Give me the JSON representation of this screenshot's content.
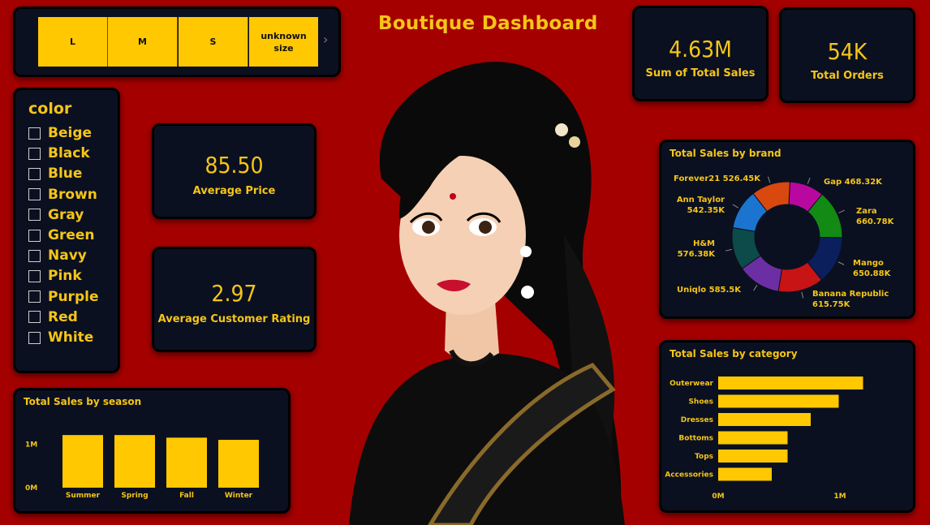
{
  "dashboard_title": "Boutique Dashboard",
  "size_slicer": {
    "options": [
      "L",
      "M",
      "S",
      "unknown size"
    ]
  },
  "color_slicer": {
    "heading": "color",
    "options": [
      "Beige",
      "Black",
      "Blue",
      "Brown",
      "Gray",
      "Green",
      "Navy",
      "Pink",
      "Purple",
      "Red",
      "White"
    ]
  },
  "kpis": {
    "total_sales": {
      "value": "4.63M",
      "label": "Sum of Total Sales"
    },
    "total_orders": {
      "value": "54K",
      "label": "Total Orders"
    },
    "avg_price": {
      "value": "85.50",
      "label": "Average Price"
    },
    "avg_rating": {
      "value": "2.97",
      "label": "Average Customer Rating"
    }
  },
  "colors": {
    "background": "#a50000",
    "card": "#0b1020",
    "accent": "#ffc800"
  },
  "chart_data": [
    {
      "type": "pie",
      "title": "Total Sales by brand",
      "categories": [
        "Gap",
        "Zara",
        "Mango",
        "Banana Republic",
        "Uniqlo",
        "H&M",
        "Ann Taylor",
        "Forever21"
      ],
      "values": [
        468.32,
        660.78,
        650.88,
        615.75,
        585.5,
        576.38,
        542.35,
        526.45
      ],
      "labels": [
        "Gap 468.32K",
        "Zara 660.78K",
        "Mango 650.88K",
        "Banana Republic 615.75K",
        "Uniqlo 585.5K",
        "H&M 576.38K",
        "Ann Taylor 542.35K",
        "Forever21 526.45K"
      ],
      "colors": [
        "#b8089f",
        "#138a13",
        "#0a1f5c",
        "#c81414",
        "#6b2fa3",
        "#0d4a4a",
        "#1b75d0",
        "#d9480f"
      ]
    },
    {
      "type": "bar",
      "orientation": "horizontal",
      "title": "Total Sales by category",
      "categories": [
        "Outerwear",
        "Shoes",
        "Dresses",
        "Bottoms",
        "Tops",
        "Accessories"
      ],
      "values": [
        1.19,
        0.99,
        0.76,
        0.57,
        0.57,
        0.44
      ],
      "xticks": [
        "0M",
        "1M"
      ],
      "xlim": [
        0,
        1.6
      ]
    },
    {
      "type": "bar",
      "title": "Total Sales by season",
      "categories": [
        "Summer",
        "Spring",
        "Fall",
        "Winter"
      ],
      "values": [
        1.21,
        1.21,
        1.15,
        1.1
      ],
      "yticks": [
        "0M",
        "1M"
      ],
      "ylim": [
        0,
        1.25
      ]
    }
  ]
}
